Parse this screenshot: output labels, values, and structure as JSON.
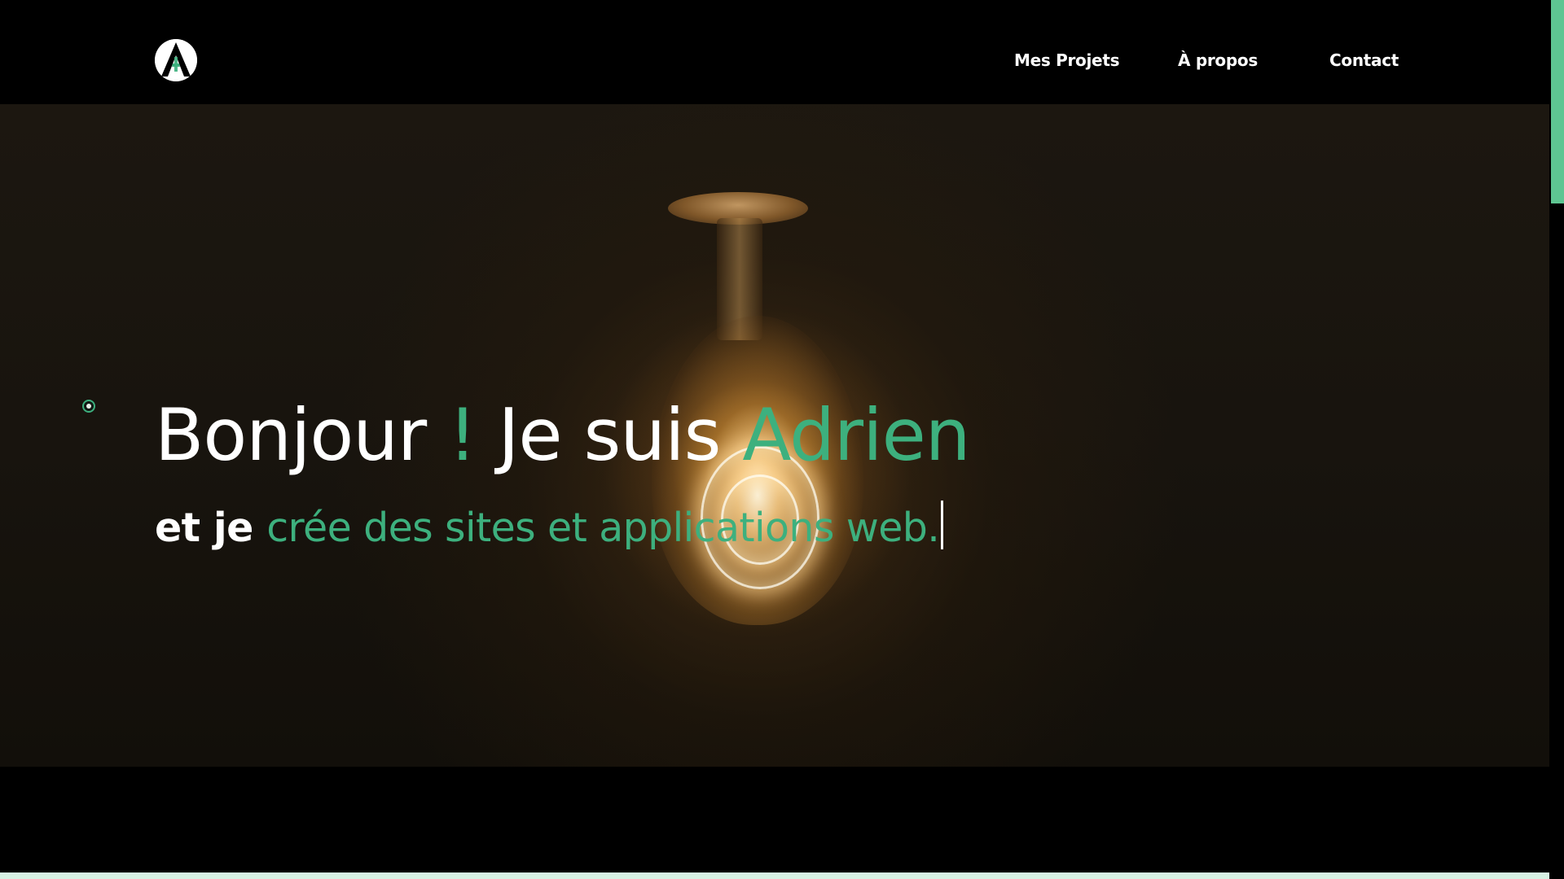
{
  "header": {
    "logo_icon": "a-monogram-logo-icon",
    "nav": [
      {
        "label": "Mes Projets"
      },
      {
        "label": "À propos"
      },
      {
        "label": "Contact"
      }
    ]
  },
  "hero": {
    "headline": {
      "part1": "Bonjour ",
      "exclamation": "!",
      "part2": " Je suis ",
      "name": "Adrien"
    },
    "subline": {
      "prefix": "et je ",
      "highlight": "crée des sites et applications web."
    },
    "background_image": "light-bulb-image",
    "indicator_icon": "scroll-indicator-icon"
  },
  "colors": {
    "accent": "#3db07e",
    "scroll_thumb": "#5ec592",
    "background": "#000000",
    "text": "#ffffff"
  }
}
